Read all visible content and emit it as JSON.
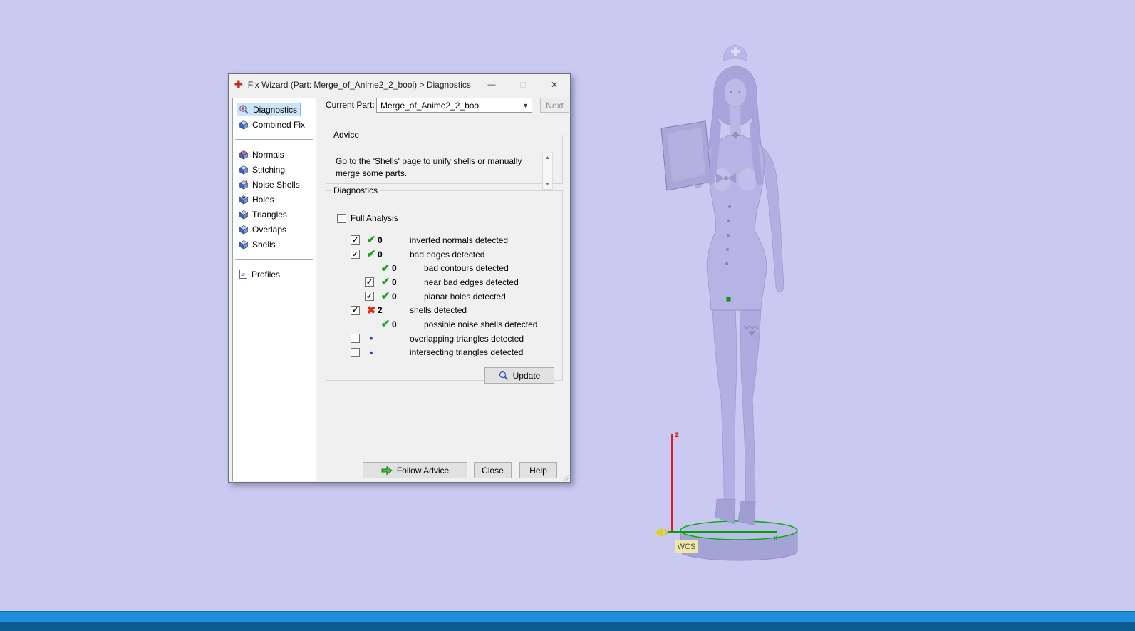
{
  "window": {
    "title": "Fix Wizard (Part: Merge_of_Anime2_2_bool) > Diagnostics"
  },
  "sidebar": {
    "items": [
      {
        "label": "Diagnostics",
        "icon": "magnifier-icon",
        "selected": true
      },
      {
        "label": "Combined Fix",
        "icon": "cube-icon",
        "selected": false
      },
      {
        "label": "Normals",
        "icon": "cube-icon",
        "selected": false
      },
      {
        "label": "Stitching",
        "icon": "cube-icon",
        "selected": false
      },
      {
        "label": "Noise Shells",
        "icon": "cube-icon",
        "selected": false
      },
      {
        "label": "Holes",
        "icon": "cube-icon",
        "selected": false
      },
      {
        "label": "Triangles",
        "icon": "cube-icon",
        "selected": false
      },
      {
        "label": "Overlaps",
        "icon": "cube-icon",
        "selected": false
      },
      {
        "label": "Shells",
        "icon": "cube-icon",
        "selected": false
      },
      {
        "label": "Profiles",
        "icon": "document-icon",
        "selected": false
      }
    ]
  },
  "main": {
    "current_part": {
      "label": "Current Part:",
      "value": "Merge_of_Anime2_2_bool"
    },
    "next_button": "Next",
    "advice": {
      "title": "Advice",
      "text": "Go to the 'Shells' page to unify shells or manually merge some parts."
    },
    "diagnostics": {
      "title": "Diagnostics",
      "full_analysis_label": "Full Analysis",
      "rows": [
        {
          "checkbox": "checked",
          "status": "ok",
          "count": "0",
          "label": "inverted normals detected",
          "indent": 0
        },
        {
          "checkbox": "checked",
          "status": "ok",
          "count": "0",
          "label": "bad edges detected",
          "indent": 0
        },
        {
          "checkbox": "none",
          "status": "ok",
          "count": "0",
          "label": "bad contours detected",
          "indent": 1
        },
        {
          "checkbox": "checked",
          "status": "ok",
          "count": "0",
          "label": "near bad edges detected",
          "indent": 1
        },
        {
          "checkbox": "checked",
          "status": "ok",
          "count": "0",
          "label": "planar holes detected",
          "indent": 1
        },
        {
          "checkbox": "checked",
          "status": "fail",
          "count": "2",
          "label": "shells detected",
          "indent": 0
        },
        {
          "checkbox": "none",
          "status": "ok",
          "count": "0",
          "label": "possible noise shells detected",
          "indent": 1
        },
        {
          "checkbox": "unchecked",
          "status": "dot",
          "count": "",
          "label": "overlapping triangles detected",
          "indent": 0
        },
        {
          "checkbox": "unchecked",
          "status": "dot",
          "count": "",
          "label": "intersecting triangles detected",
          "indent": 0
        }
      ],
      "update_button": "Update"
    },
    "footer": {
      "follow_advice": "Follow Advice",
      "close": "Close",
      "help": "Help"
    }
  },
  "viewport": {
    "model_name": "nurse-figurine-3d-model",
    "wcs_label": "WCS",
    "axes": {
      "x": "x",
      "y": "y",
      "z": "z"
    }
  },
  "colors": {
    "background": "#c9c9f1",
    "model_fill": "#b4b4e5",
    "ok_green": "#18a018",
    "fail_red": "#e02812",
    "marker_blue": "#2233cc",
    "axis_x_green": "#00a400",
    "axis_z_red": "#e02020",
    "axis_y_yellow": "#e5cf10",
    "taskbar_blue": "#1e8fd8"
  }
}
